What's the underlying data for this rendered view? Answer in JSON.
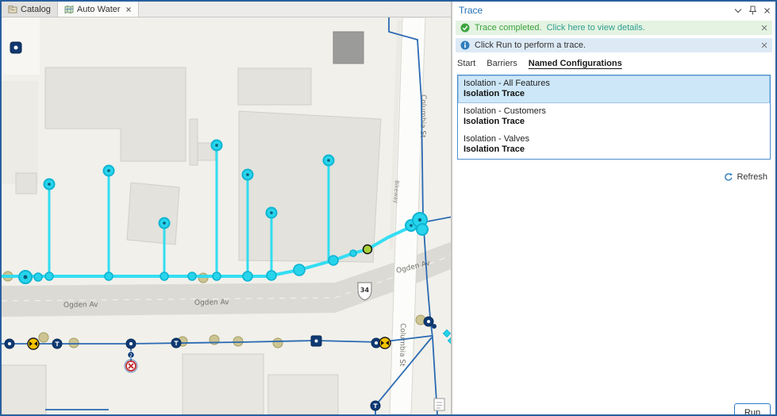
{
  "doc_tabs": {
    "catalog": "Catalog",
    "auto_water": "Auto Water"
  },
  "map": {
    "road_labels": {
      "ogden_1": "Ogden Av",
      "ogden_2": "Ogden Av",
      "ogden_3": "Ogden Av",
      "columbia_1": "Columbia St",
      "columbia_2": "Columbia St",
      "bikeway": "Bikeway",
      "route_shield": "34"
    },
    "badges": {
      "count": "2"
    },
    "colors": {
      "trace_highlight": "#29dcf2",
      "network_blue": "#2a6ab2",
      "start_point_green": "#a8cf38",
      "valve_yellow": "#f3c200",
      "closed_valve_red": "#c0272d"
    }
  },
  "trace_panel": {
    "title": "Trace",
    "success_message": {
      "text": "Trace completed.",
      "link": "Click here to view details."
    },
    "info_message": {
      "text": "Click Run to perform a trace."
    },
    "tabs": [
      {
        "label": "Start"
      },
      {
        "label": "Barriers"
      },
      {
        "label": "Named Configurations"
      }
    ],
    "configurations": [
      {
        "name": "Isolation - All Features",
        "type": "Isolation Trace"
      },
      {
        "name": "Isolation - Customers",
        "type": "Isolation Trace"
      },
      {
        "name": "Isolation - Valves",
        "type": "Isolation Trace"
      }
    ],
    "refresh_label": "Refresh",
    "run_label": "Run"
  }
}
